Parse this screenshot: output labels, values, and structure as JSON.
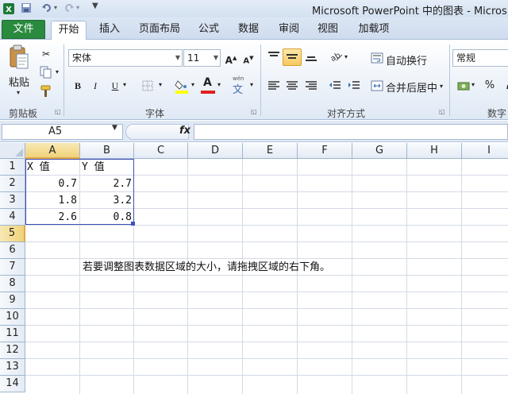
{
  "title_bar": {
    "title": "Microsoft PowerPoint 中的图表 - Micros"
  },
  "tabs": {
    "file": "文件",
    "items": [
      "开始",
      "插入",
      "页面布局",
      "公式",
      "数据",
      "审阅",
      "视图",
      "加载项"
    ],
    "active": "开始"
  },
  "ribbon": {
    "clipboard": {
      "paste_label": "粘贴",
      "group_label": "剪贴板"
    },
    "font": {
      "font_name": "宋体",
      "font_size": "11",
      "grow_label": "A",
      "shrink_label": "A",
      "bold": "B",
      "italic": "I",
      "underline": "U",
      "color_letter": "A",
      "phonetic": "wén",
      "group_label": "字体",
      "colors": {
        "fill": "#ffff00",
        "font": "#e02020"
      }
    },
    "alignment": {
      "wrap_text": "自动换行",
      "merge_center": "合并后居中",
      "group_label": "对齐方式"
    },
    "number": {
      "format": "常规",
      "percent": "%",
      "comma": ",",
      "group_label": "数字"
    }
  },
  "formula_bar": {
    "name_box": "A5",
    "fx": "fx",
    "formula": ""
  },
  "sheet": {
    "columns": [
      "A",
      "B",
      "C",
      "D",
      "E",
      "F",
      "G",
      "H",
      "I"
    ],
    "rows": [
      "1",
      "2",
      "3",
      "4",
      "5",
      "6",
      "7",
      "8",
      "9",
      "10",
      "11",
      "12",
      "13",
      "14"
    ],
    "selected_cell": "A5",
    "cells": {
      "A1": "X 值",
      "B1": "Y 值",
      "A2": "0.7",
      "B2": "2.7",
      "A3": "1.8",
      "B3": "3.2",
      "A4": "2.6",
      "B4": "0.8"
    },
    "note": "若要调整图表数据区域的大小，请拖拽区域的右下角。"
  }
}
